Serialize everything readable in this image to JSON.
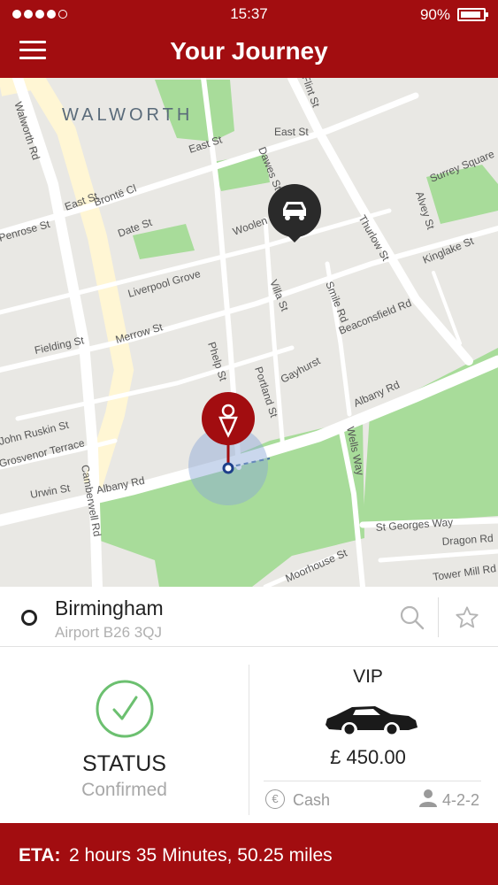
{
  "status_bar": {
    "time": "15:37",
    "battery": "90%"
  },
  "header": {
    "title": "Your Journey",
    "menu_icon": "hamburger-menu-icon"
  },
  "map": {
    "area": "WALWORTH",
    "streets": [
      "Walworth Rd",
      "East St",
      "Brontë Cl",
      "Date St",
      "Dawes St",
      "Woolen",
      "Thurlow St",
      "Alvey St",
      "Surrey Square",
      "Kinglake St",
      "Liverpool Grove",
      "Villa St",
      "Smile Rd",
      "Beaconsfield Rd",
      "Merrow St",
      "Fielding St",
      "Phelp St",
      "Gayhurst",
      "Portland St",
      "Albany Rd",
      "John Ruskin St",
      "Grosvenor Terrace",
      "Urwin St",
      "Camberwell Rd",
      "Wells Way",
      "St Georges Way",
      "Dragon Rd",
      "Tower Mill Rd",
      "Flint St",
      "Penrose St",
      "Moorhouse St"
    ],
    "vehicle_marker_icon": "car-icon",
    "pickup_marker_icon": "person-pin-icon"
  },
  "location": {
    "city": "Birmingham",
    "detail": "Airport B26 3QJ"
  },
  "status": {
    "title": "STATUS",
    "value": "Confirmed",
    "color": "#6cc070"
  },
  "vehicle": {
    "class": "VIP",
    "price": "£ 450.00",
    "payment": "Cash",
    "passengers": "4-2-2"
  },
  "eta": {
    "label": "ETA:",
    "text": "2 hours 35 Minutes, 50.25 miles"
  },
  "colors": {
    "brand": "#a20d10",
    "park": "#a8dc9a",
    "road": "#ffffff",
    "major_road": "#fff6d4",
    "map_bg": "#e9e8e4"
  }
}
